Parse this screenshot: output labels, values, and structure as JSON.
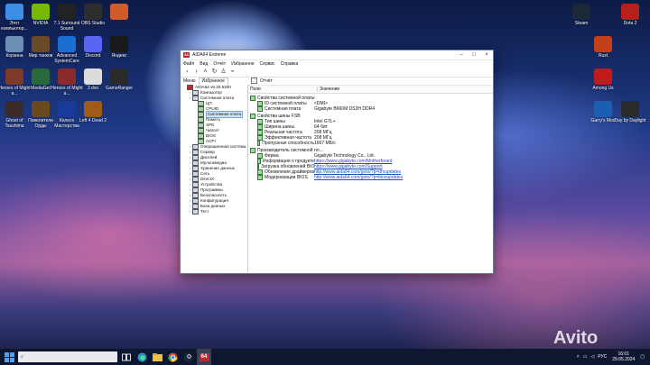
{
  "desktop_left": [
    {
      "label": "Этот компьютер...",
      "icon": "computer-icon",
      "color": "#3d8ee6"
    },
    {
      "label": "NVIDIA",
      "icon": "nvidia-icon",
      "color": "#76b900"
    },
    {
      "label": "7.1 Surround Sound",
      "icon": "surround-icon",
      "color": "#222"
    },
    {
      "label": "OBS Studio",
      "icon": "obs-icon",
      "color": "#2d2d2d"
    },
    {
      "label": "",
      "icon": "photo-icon",
      "color": "#d05a2a"
    },
    {
      "label": "Корзина",
      "icon": "recycle-bin-icon",
      "color": "#6d8fb3"
    },
    {
      "label": "Мир танков",
      "icon": "tanks-icon",
      "color": "#6b4a2a"
    },
    {
      "label": "Advanced SystemCare",
      "icon": "systemcare-icon",
      "color": "#1a6fd0"
    },
    {
      "label": "Discord",
      "icon": "discord-icon",
      "color": "#5865f2"
    },
    {
      "label": "Яндекс",
      "icon": "yandex-icon",
      "color": "#1a1a1a"
    },
    {
      "label": "Heroes of Might a...",
      "icon": "heroes-icon",
      "color": "#7a3b2a"
    },
    {
      "label": "MediaGet",
      "icon": "mediaget-icon",
      "color": "#2a6a3a"
    },
    {
      "label": "Heroes of Might a...",
      "icon": "heroes-icon",
      "color": "#8a2a2a"
    },
    {
      "label": "3.dxn",
      "icon": "file-icon",
      "color": "#dcdcdc"
    },
    {
      "label": "GameRanger",
      "icon": "gameranger-icon",
      "color": "#2a2a2a"
    },
    {
      "label": "Ghost of Tsushima",
      "icon": "ghost-icon",
      "color": "#3a2a2a"
    },
    {
      "label": "Повелители Орды",
      "icon": "horde-icon",
      "color": "#6a4a1a"
    },
    {
      "label": "Колесо Мастерства",
      "icon": "wheel-icon",
      "color": "#1a3a9a"
    },
    {
      "label": "Left 4 Dead 2",
      "icon": "l4d2-icon",
      "color": "#a05a1a"
    }
  ],
  "desktop_right": [
    {
      "label": "Steam",
      "icon": "steam-icon",
      "color": "#1b2838"
    },
    {
      "label": "Dota 2",
      "icon": "dota-icon",
      "color": "#b2221a"
    },
    {
      "label": "Rust",
      "icon": "rust-icon",
      "color": "#c4401a"
    },
    {
      "label": "Among Us",
      "icon": "amongus-icon",
      "color": "#c21a1a"
    },
    {
      "label": "Garry's Mod",
      "icon": "gmod-icon",
      "color": "#1a5fb4"
    },
    {
      "label": "Day by Daylight",
      "icon": "dbd-icon",
      "color": "#2a2a2a"
    }
  ],
  "window": {
    "title": "AIDA64 Extreme",
    "menu": [
      "Файл",
      "Вид",
      "Отчёт",
      "Избранное",
      "Сервис",
      "Справка"
    ],
    "tabs": [
      "Меню",
      "Избранное"
    ],
    "report_label": "Отчёт",
    "col_field": "Поле",
    "col_value": "Значение",
    "tree": [
      {
        "label": "AIDA64 v6.20.5300",
        "indent": 0,
        "toggle": "",
        "icon": "aida-icon",
        "sel": false
      },
      {
        "label": "Компьютер",
        "indent": 1,
        "toggle": ">",
        "icon": "computer-icon",
        "sel": false
      },
      {
        "label": "Системная плата",
        "indent": 1,
        "toggle": "v",
        "icon": "motherboard-icon",
        "sel": false
      },
      {
        "label": "ЦП",
        "indent": 2,
        "toggle": "",
        "icon": "cpu-icon",
        "sel": false
      },
      {
        "label": "CPUID",
        "indent": 2,
        "toggle": "",
        "icon": "cpuid-icon",
        "sel": false
      },
      {
        "label": "Системная плата",
        "indent": 2,
        "toggle": "",
        "icon": "motherboard-icon",
        "sel": true
      },
      {
        "label": "Память",
        "indent": 2,
        "toggle": "",
        "icon": "memory-icon",
        "sel": false
      },
      {
        "label": "SPD",
        "indent": 2,
        "toggle": "",
        "icon": "spd-icon",
        "sel": false
      },
      {
        "label": "Чипсет",
        "indent": 2,
        "toggle": "",
        "icon": "chipset-icon",
        "sel": false
      },
      {
        "label": "BIOS",
        "indent": 2,
        "toggle": "",
        "icon": "bios-icon",
        "sel": false
      },
      {
        "label": "ACPI",
        "indent": 2,
        "toggle": "",
        "icon": "acpi-icon",
        "sel": false
      },
      {
        "label": "Операционная система",
        "indent": 1,
        "toggle": ">",
        "icon": "os-icon",
        "sel": false
      },
      {
        "label": "Сервер",
        "indent": 1,
        "toggle": ">",
        "icon": "server-icon",
        "sel": false
      },
      {
        "label": "Дисплей",
        "indent": 1,
        "toggle": ">",
        "icon": "display-icon",
        "sel": false
      },
      {
        "label": "Мультимедиа",
        "indent": 1,
        "toggle": ">",
        "icon": "multimedia-icon",
        "sel": false
      },
      {
        "label": "Хранение данных",
        "indent": 1,
        "toggle": ">",
        "icon": "storage-icon",
        "sel": false
      },
      {
        "label": "Сеть",
        "indent": 1,
        "toggle": ">",
        "icon": "network-icon",
        "sel": false
      },
      {
        "label": "DirectX",
        "indent": 1,
        "toggle": ">",
        "icon": "directx-icon",
        "sel": false
      },
      {
        "label": "Устройства",
        "indent": 1,
        "toggle": ">",
        "icon": "devices-icon",
        "sel": false
      },
      {
        "label": "Программы",
        "indent": 1,
        "toggle": ">",
        "icon": "programs-icon",
        "sel": false
      },
      {
        "label": "Безопасность",
        "indent": 1,
        "toggle": ">",
        "icon": "security-icon",
        "sel": false
      },
      {
        "label": "Конфигурация",
        "indent": 1,
        "toggle": ">",
        "icon": "config-icon",
        "sel": false
      },
      {
        "label": "База данных",
        "indent": 1,
        "toggle": ">",
        "icon": "database-icon",
        "sel": false
      },
      {
        "label": "Тест",
        "indent": 1,
        "toggle": ">",
        "icon": "test-icon",
        "sel": false
      }
    ],
    "groups": [
      {
        "title": "Свойства системной платы",
        "rows": [
          {
            "field": "ID системной платы",
            "value": "<DMI>",
            "link": false
          },
          {
            "field": "Системная плата",
            "value": "Gigabyte B660M DS3H DDR4",
            "link": false
          }
        ]
      },
      {
        "title": "Свойства шины FSB",
        "rows": [
          {
            "field": "Тип шины",
            "value": "Intel GTL+",
            "link": false
          },
          {
            "field": "Ширина шины",
            "value": "64 бит",
            "link": false
          },
          {
            "field": "Реальная частота",
            "value": "208 МГц",
            "link": false
          },
          {
            "field": "Эффективная частота",
            "value": "208 МГц",
            "link": false
          },
          {
            "field": "Пропускная способность",
            "value": "1667 МБ/с",
            "link": false
          }
        ]
      },
      {
        "title": "Производитель системной пл...",
        "rows": [
          {
            "field": "Фирма",
            "value": "Gigabyte Technology Co., Ltd.",
            "link": false
          },
          {
            "field": "Информация о продукте",
            "value": "https://www.gigabyte.com/Motherboard",
            "link": true
          },
          {
            "field": "Загрузка обновлений BIOS",
            "value": "https://www.gigabyte.com/Support",
            "link": true
          },
          {
            "field": "Обновления драйверов",
            "value": "http://www.aida64.com/goto/?p=drvupdates",
            "link": true
          },
          {
            "field": "Модернизации BIOS",
            "value": "http://www.aida64.com/goto/?p=biosupdates",
            "link": true
          }
        ]
      }
    ]
  },
  "taskbar": {
    "search_placeholder": "",
    "tray_lang": "РУС",
    "time": "16:01",
    "date": "29.05.2024"
  },
  "watermark": "Avito"
}
